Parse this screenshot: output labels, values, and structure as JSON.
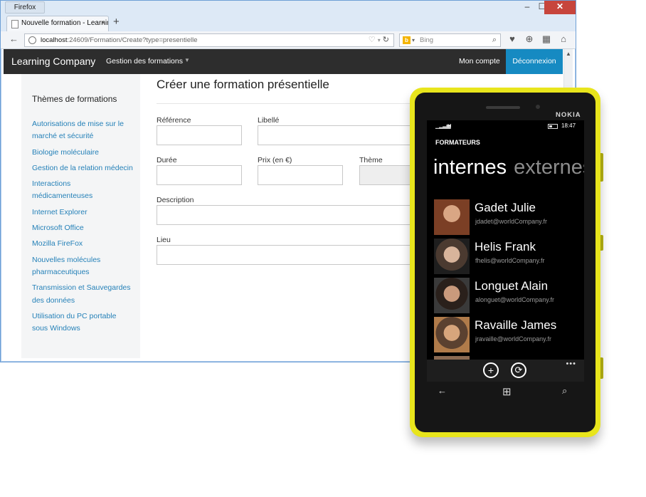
{
  "browser": {
    "app_name": "Firefox",
    "controls": {
      "minimize": "–",
      "maximize": "☐",
      "close": "✕"
    },
    "tab_title": "Nouvelle formation - Learnin...",
    "tab_close": "×",
    "new_tab": "+",
    "back": "←",
    "url_host": "localhost",
    "url_path": ":24609/Formation/Create?type=presentielle",
    "search_placeholder": "Bing",
    "icons": [
      "back-arrow-icon",
      "globe-icon",
      "heart-icon",
      "refresh-icon",
      "bing-icon",
      "search-icon",
      "bookmark-icon",
      "download-icon",
      "qr-code-icon",
      "home-icon"
    ]
  },
  "site": {
    "brand": "Learning Company",
    "menu_label": "Gestion des formations",
    "account_label": "Mon compte",
    "logout_label": "Déconnexion",
    "accent": "#168ac2"
  },
  "sidebar": {
    "title": "Thèmes de formations",
    "items": [
      "Autorisations de mise sur le marché et sécurité",
      "Biologie moléculaire",
      "Gestion de la relation médecin",
      "Interactions médicamenteuses",
      "Internet Explorer",
      "Microsoft Office",
      "Mozilla FireFox",
      "Nouvelles molécules pharmaceutiques",
      "Transmission et Sauvegardes des données",
      "Utilisation du PC portable sous Windows"
    ]
  },
  "form": {
    "title": "Créer une formation présentielle",
    "reference_label": "Référence",
    "libelle_label": "Libellé",
    "duree_label": "Durée",
    "prix_label": "Prix (en €)",
    "theme_label": "Thème",
    "description_label": "Description",
    "lieu_label": "Lieu"
  },
  "phone": {
    "brand": "NOKIA",
    "network": "H",
    "time": "18:47",
    "app_title": "FORMATEURS",
    "pivot_active": "internes",
    "pivot_other": "externes",
    "contacts": [
      {
        "name": "Gadet Julie",
        "email": "jdadet@worldCompany.fr",
        "avatar_color": "#8a5a3c"
      },
      {
        "name": "Helis Frank",
        "email": "fhelis@worldCompany.fr",
        "avatar_color": "#6b5a4e"
      },
      {
        "name": "Longuet Alain",
        "email": "alonguet@worldCompany.fr",
        "avatar_color": "#7a5e4a"
      },
      {
        "name": "Ravaille James",
        "email": "jravaille@worldCompany.fr",
        "avatar_color": "#8c6a4c"
      }
    ],
    "add_icon": "+",
    "sync_icon": "⟳",
    "more_icon": "•••",
    "back_icon": "←",
    "windows_icon": "⊞",
    "search_icon": "⌕",
    "bezel_color": "#e8e51c"
  }
}
